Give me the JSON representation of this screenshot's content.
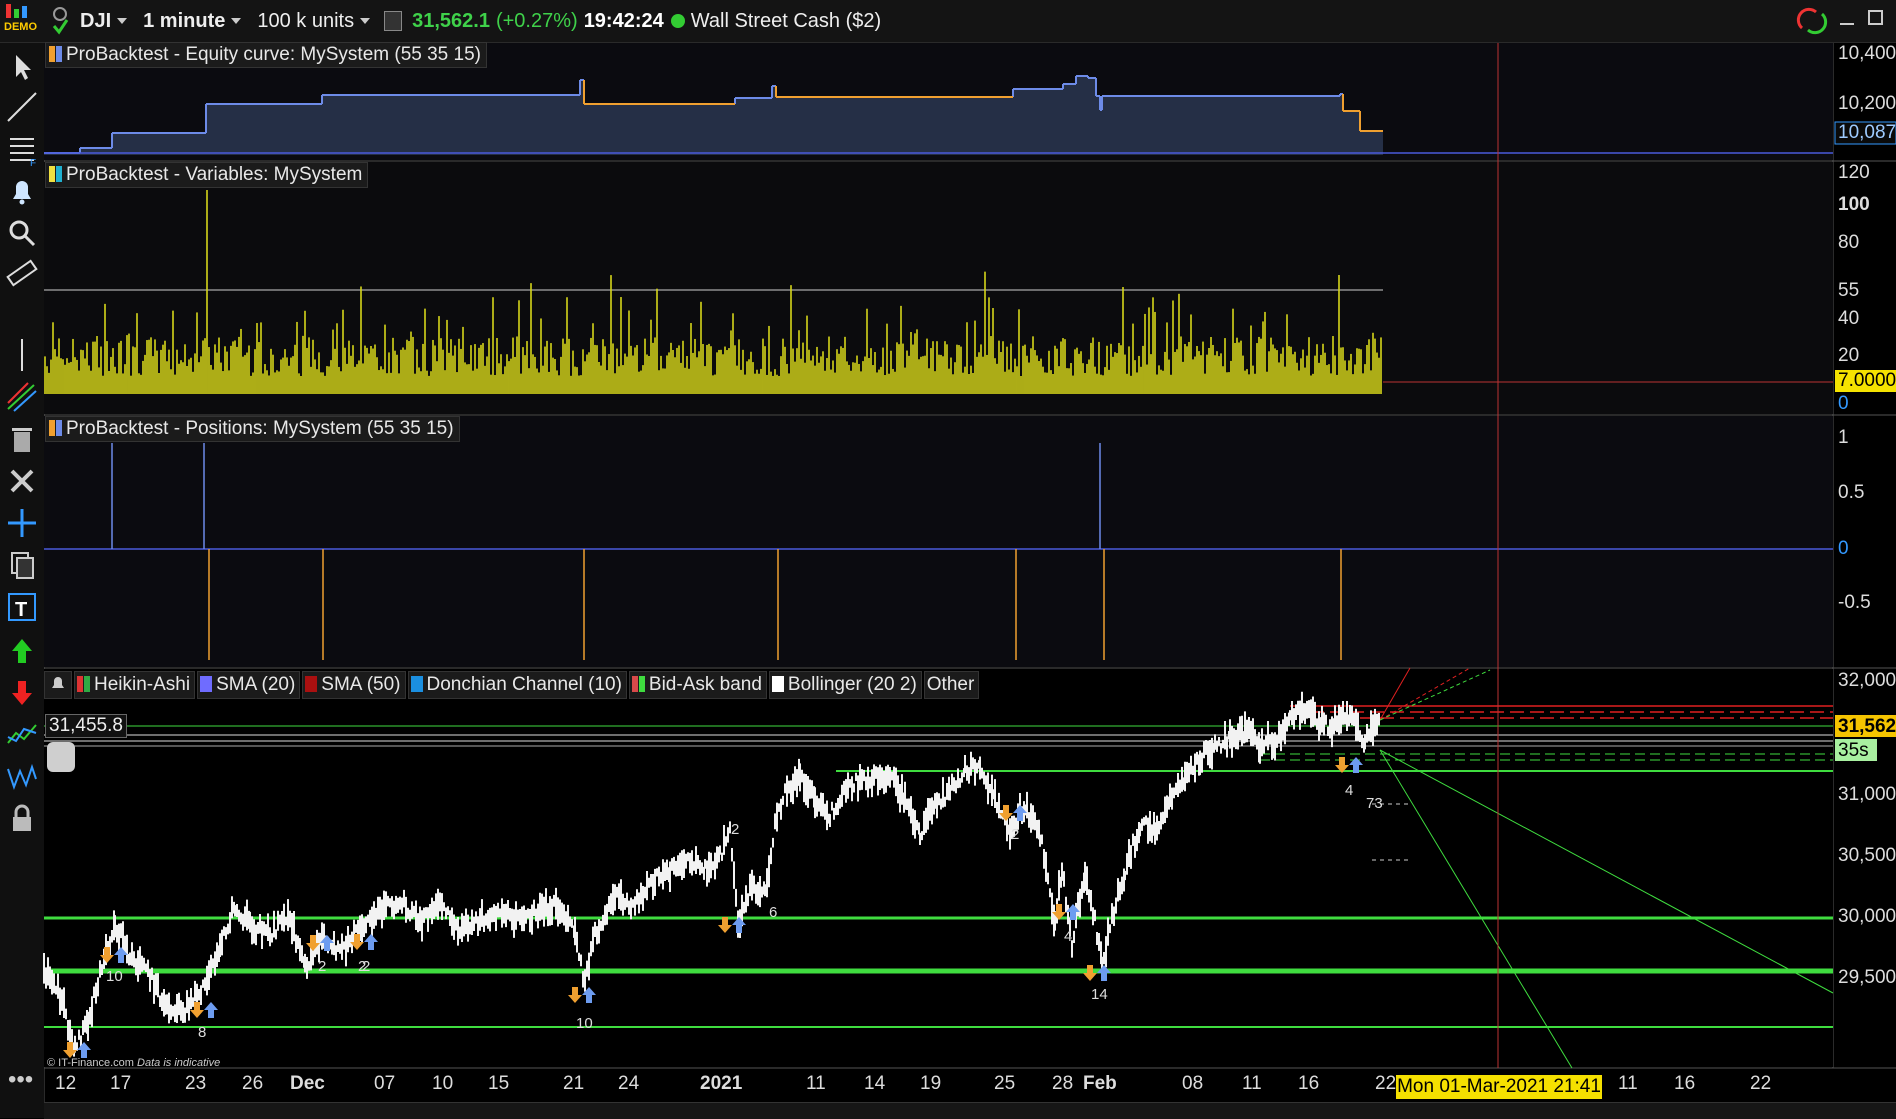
{
  "toolbar": {
    "badge": "DEMO",
    "symbol": "DJI",
    "interval": "1 minute",
    "units": "100 k units",
    "price": "31,562.1",
    "change": "(+0.27%)",
    "time": "19:42:24",
    "market": "Wall Street Cash ($2)"
  },
  "panels": {
    "equity": {
      "label": "ProBacktest - Equity curve: MySystem (55 35 15)",
      "axis": [
        "10,400",
        "10,200"
      ],
      "current": "10,087"
    },
    "variables": {
      "label": "ProBacktest - Variables: MySystem",
      "axis": [
        "120",
        "100",
        "80",
        "55",
        "40",
        "20",
        "0"
      ],
      "current": "7.0000"
    },
    "positions": {
      "label": "ProBacktest - Positions: MySystem (55 35 15)",
      "axis": [
        "1",
        "0.5",
        "0",
        "-0.5"
      ]
    }
  },
  "legend": [
    {
      "label": "Heikin-Ashi",
      "color": "#2faa44"
    },
    {
      "label": "SMA (20)",
      "color": "#6f6cff"
    },
    {
      "label": "SMA (50)",
      "color": "#aa1010"
    },
    {
      "label": "Donchian Channel (10)",
      "color": "#1b8fe0"
    },
    {
      "label": "Bid-Ask band",
      "color": "#d84a4a"
    },
    {
      "label": "Bollinger (20 2)",
      "color": "#ffffff"
    },
    {
      "label": "Other",
      "color": ""
    }
  ],
  "price_chart": {
    "axis": [
      "32,000",
      "31,500",
      "31,000",
      "30,500",
      "30,000",
      "29,500"
    ],
    "current": "31,562",
    "countdown": "35s",
    "left_value": "31,455.8",
    "order_labels": [
      "10",
      "8",
      "2",
      "2",
      "2",
      "10",
      "2",
      "6",
      "2",
      "4",
      "14",
      "4",
      "73"
    ],
    "credit": "© IT-Finance.com",
    "credit_note": "Data is indicative"
  },
  "x_axis": [
    "12",
    "17",
    "23",
    "26",
    "Dec",
    "07",
    "10",
    "15",
    "21",
    "24",
    "2021",
    "11",
    "14",
    "19",
    "25",
    "28",
    "Feb",
    "08",
    "11",
    "16",
    "22",
    "11",
    "16",
    "22"
  ],
  "cursor_date": "Mon 01-Mar-2021 21:41"
}
